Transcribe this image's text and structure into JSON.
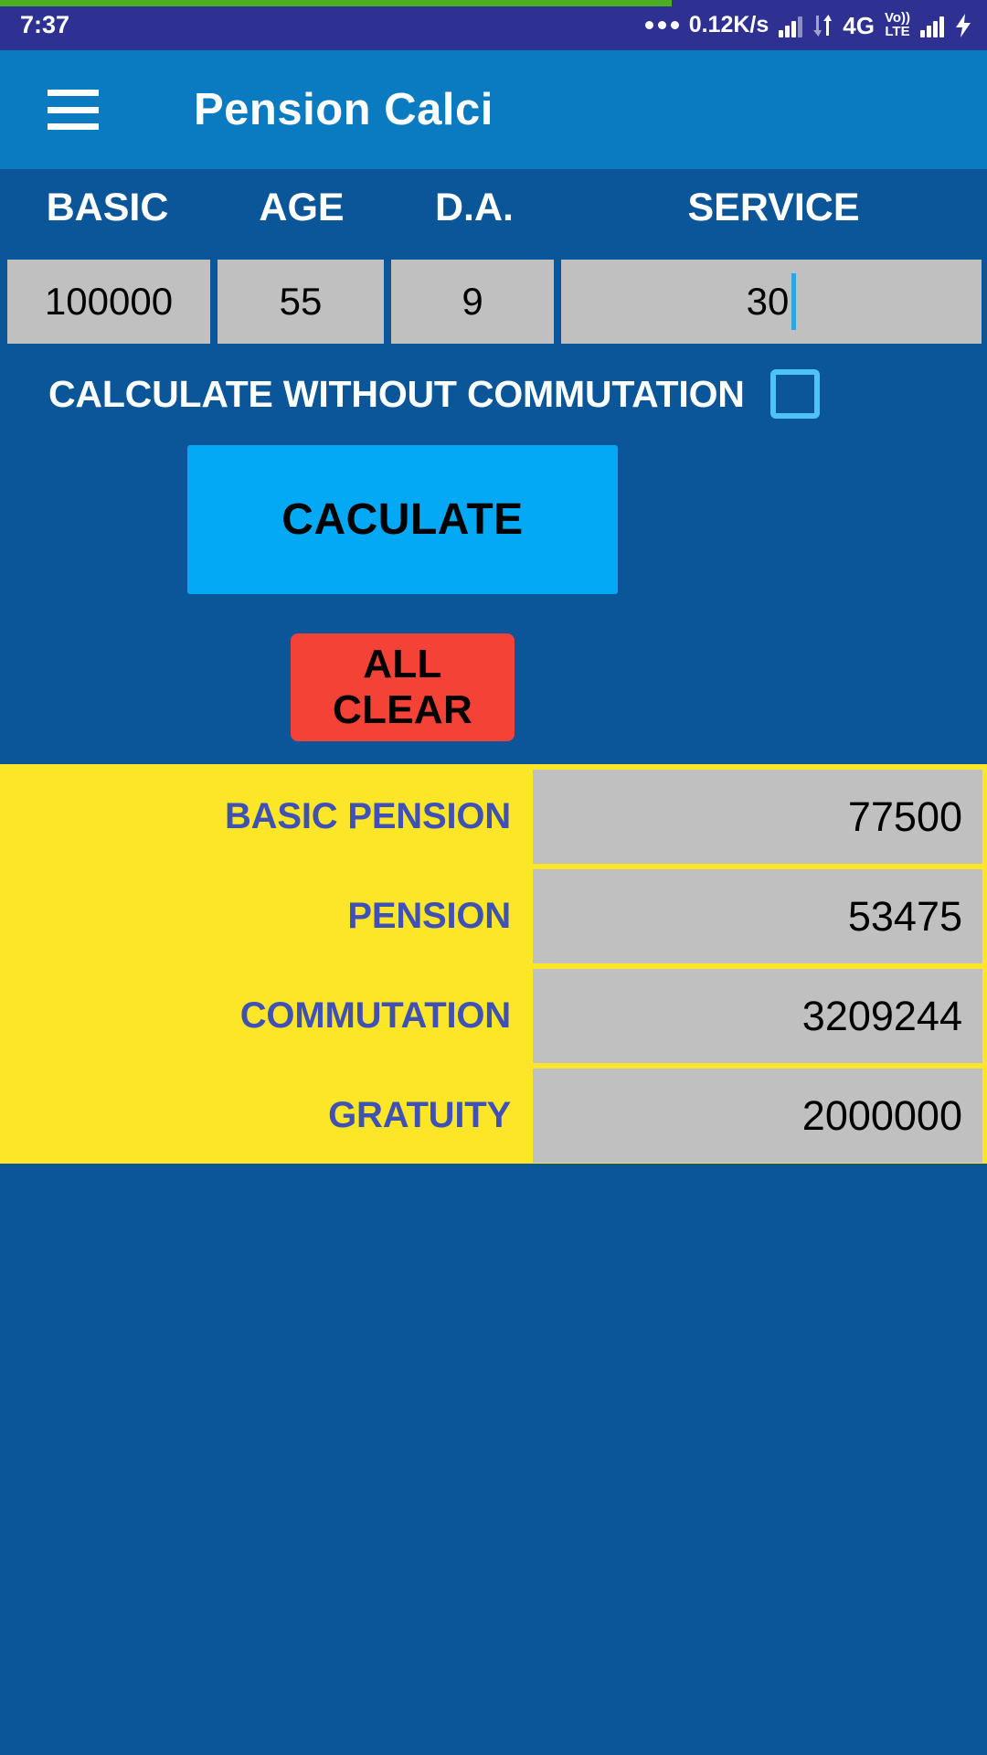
{
  "status_bar": {
    "time": "7:37",
    "dots_icon": "more-dots-icon",
    "network_speed": "0.12K/s",
    "signal_icon_1": "signal-bars-icon",
    "data_arrows_icon": "data-transfer-arrows-icon",
    "network_type": "4G",
    "volte_top": "Vo))",
    "volte_bottom": "LTE",
    "signal_icon_2": "signal-bars-icon",
    "battery_icon": "battery-charging-bolt-icon"
  },
  "app_bar": {
    "menu_icon": "hamburger-menu-icon",
    "title": "Pension Calci"
  },
  "inputs": {
    "labels": [
      "BASIC",
      "AGE",
      "D.A.",
      "SERVICE"
    ],
    "values": [
      "100000",
      "55",
      "9",
      "30"
    ],
    "focused_field": "SERVICE"
  },
  "options": {
    "checkbox_label": "CALCULATE WITHOUT COMMUTATION",
    "checkbox_checked": false
  },
  "actions": {
    "calculate_label": "CACULATE",
    "clear_label": "ALL CLEAR"
  },
  "results": {
    "rows": [
      {
        "label": "BASIC PENSION",
        "value": "77500"
      },
      {
        "label": "PENSION",
        "value": "53475"
      },
      {
        "label": "COMMUTATION",
        "value": "3209244"
      },
      {
        "label": "GRATUITY",
        "value": "2000000"
      }
    ]
  },
  "colors": {
    "status_bar": "#2E3192",
    "progress": "#4CAF22",
    "app_bar": "#0B7BC1",
    "body": "#0A5699",
    "calculate_button": "#03A9F4",
    "clear_button": "#F44336",
    "results_background": "#FCE627",
    "results_label": "#3F51B5",
    "field_background": "#C0C0C0",
    "checkbox_outline": "#4FC3F7",
    "caret": "#2CA6E0"
  }
}
